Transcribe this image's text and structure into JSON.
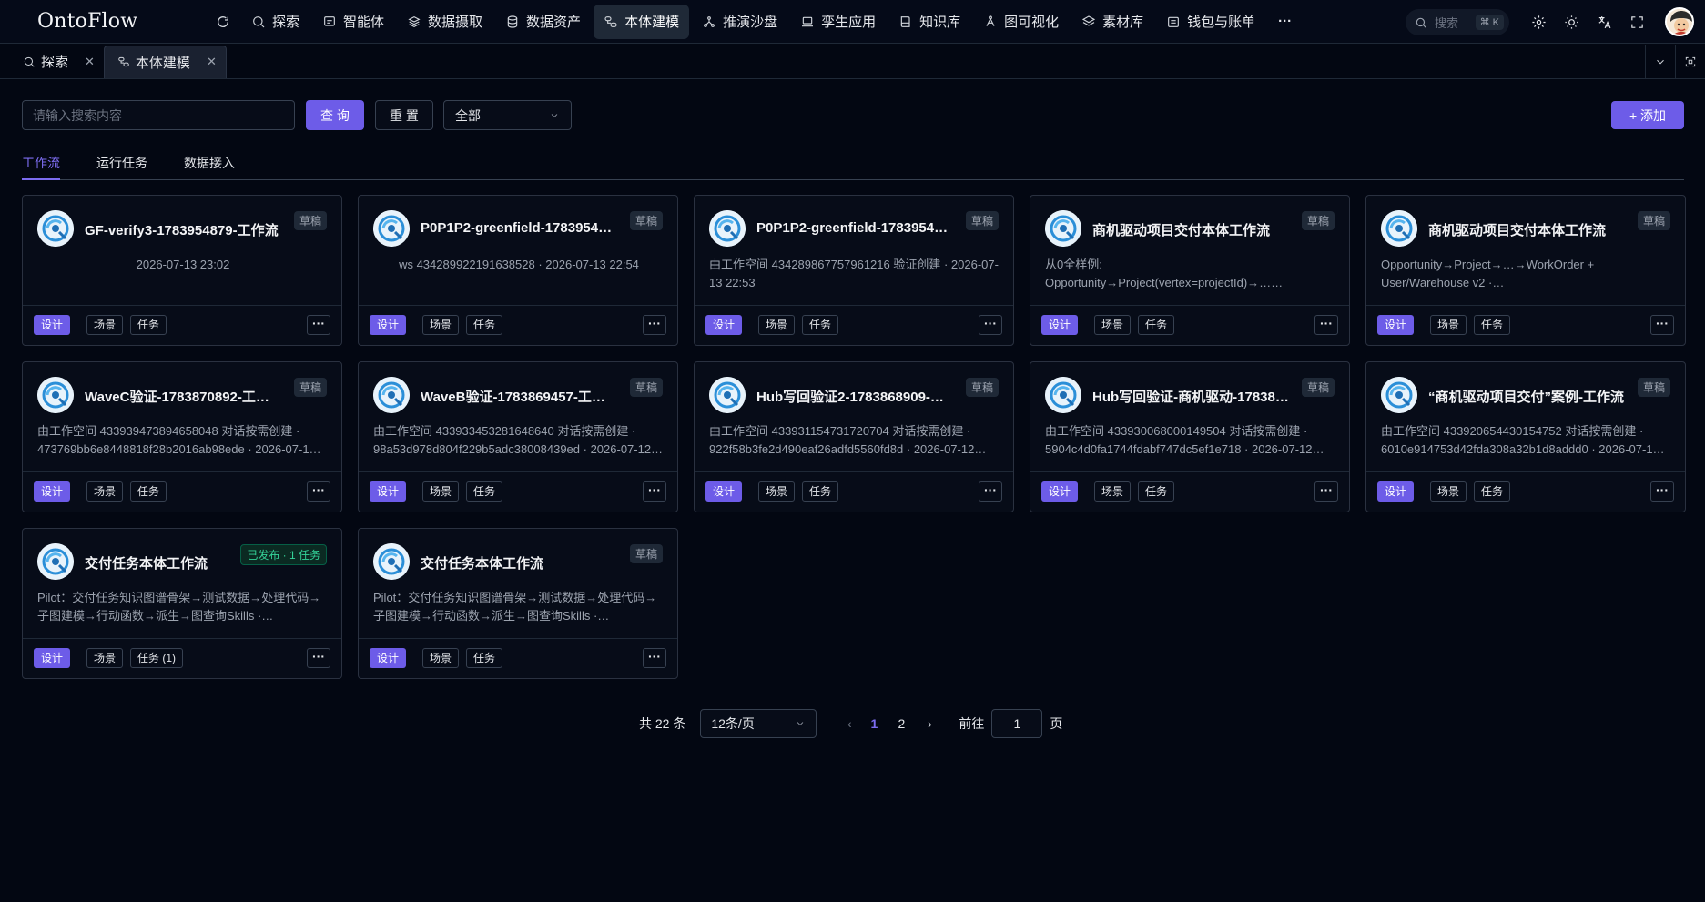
{
  "app": {
    "logo": "OntoFlow"
  },
  "nav": {
    "items": [
      {
        "label": "探索",
        "icon": "search-icon"
      },
      {
        "label": "智能体",
        "icon": "chat-icon"
      },
      {
        "label": "数据摄取",
        "icon": "layers-icon"
      },
      {
        "label": "数据资产",
        "icon": "database-icon"
      },
      {
        "label": "本体建模",
        "icon": "ontology-icon",
        "active": true
      },
      {
        "label": "推演沙盘",
        "icon": "network-icon"
      },
      {
        "label": "孪生应用",
        "icon": "laptop-icon"
      },
      {
        "label": "知识库",
        "icon": "book-icon"
      },
      {
        "label": "图可视化",
        "icon": "graph-icon"
      },
      {
        "label": "素材库",
        "icon": "stack-icon"
      },
      {
        "label": "钱包与账单",
        "icon": "wallet-icon"
      },
      {
        "label": "···",
        "icon": "more-icon"
      }
    ],
    "search_placeholder": "搜索",
    "search_shortcut": "⌘ K"
  },
  "tabs": [
    {
      "label": "探索",
      "icon": "search-icon"
    },
    {
      "label": "本体建模",
      "icon": "ontology-icon",
      "active": true
    }
  ],
  "filters": {
    "search_placeholder": "请输入搜索内容",
    "query_label": "查 询",
    "reset_label": "重 置",
    "select_value": "全部",
    "add_label": "+ 添加"
  },
  "subtabs": [
    "工作流",
    "运行任务",
    "数据接入"
  ],
  "cards": [
    {
      "title": "GF-verify3-1783954879-工作流",
      "badge": "草稿",
      "desc": "2026-07-13 23:02",
      "center": true
    },
    {
      "title": "P0P1P2-greenfield-1783954…",
      "badge": "草稿",
      "desc": "ws 434289922191638528 · 2026-07-13 22:54",
      "center": true
    },
    {
      "title": "P0P1P2-greenfield-1783954…",
      "badge": "草稿",
      "desc": "由工作空间 434289867757961216 验证创建 · 2026-07-13 22:53"
    },
    {
      "title": "商机驱动项目交付本体工作流",
      "badge": "草稿",
      "desc": "从0全样例:\nOpportunity→Project(vertex=projectId)→……"
    },
    {
      "title": "商机驱动项目交付本体工作流",
      "badge": "草稿",
      "desc": "Opportunity→Project→…→WorkOrder + User/Warehouse v2 ·…"
    },
    {
      "title": "WaveC验证-1783870892-工…",
      "badge": "草稿",
      "desc": "由工作空间 433939473894658048 对话按需创建 · 473769bb6e8448818f28b2016ab98ede · 2026-07-1…"
    },
    {
      "title": "WaveB验证-1783869457-工…",
      "badge": "草稿",
      "desc": "由工作空间 433933453281648640 对话按需创建 · 98a53d978d804f229b5adc38008439ed · 2026-07-12…"
    },
    {
      "title": "Hub写回验证2-1783868909-…",
      "badge": "草稿",
      "desc": "由工作空间 433931154731720704 对话按需创建 · 922f58b3fe2d490eaf26adfd5560fd8d · 2026-07-12…"
    },
    {
      "title": "Hub写回验证-商机驱动-17838…",
      "badge": "草稿",
      "desc": "由工作空间 433930068000149504 对话按需创建 · 5904c4d0fa1744fdabf747dc5ef1e718 · 2026-07-12…"
    },
    {
      "title": "“商机驱动项目交付”案例-工作流",
      "badge": "草稿",
      "desc": "由工作空间 433920654430154752 对话按需创建 · 6010e914753d42fda308a32b1d8addd0 · 2026-07-1…"
    },
    {
      "title": "交付任务本体工作流",
      "badge": "已发布 · 1 任务",
      "published": true,
      "desc": "Pilot：交付任务知识图谱骨架→测试数据→处理代码→子图建模→行动函数→派生→图查询Skills ·…",
      "task_label": "任务 (1)"
    },
    {
      "title": "交付任务本体工作流",
      "badge": "草稿",
      "desc": "Pilot：交付任务知识图谱骨架→测试数据→处理代码→子图建模→行动函数→派生→图查询Skills ·…"
    }
  ],
  "card_actions": {
    "design": "设计",
    "scene": "场景",
    "task": "任务",
    "more": "···"
  },
  "pagination": {
    "total": "共 22 条",
    "page_size": "12条/页",
    "prev": "‹",
    "pages": [
      "1",
      "2"
    ],
    "next": "›",
    "goto_label": "前往",
    "goto_value": "1",
    "page_suffix": "页"
  },
  "colors": {
    "accent": "#6d5ce8",
    "background": "#030712",
    "published": "#34d399"
  }
}
